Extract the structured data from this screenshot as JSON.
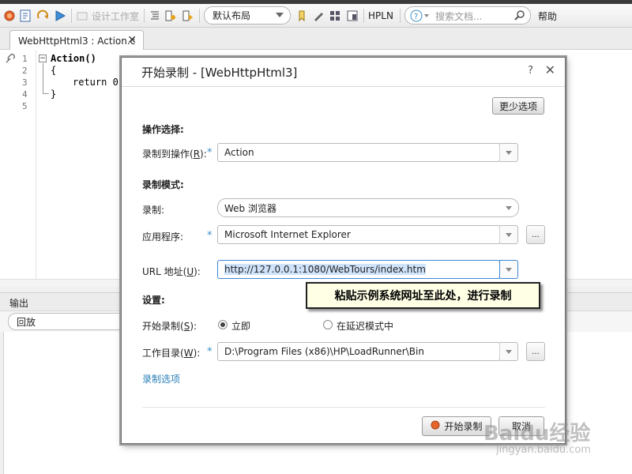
{
  "toolbar": {
    "design_workspace_label": "设计工作室",
    "layout_combo_value": "默认布局",
    "hpln_label": "HPLN",
    "search_placeholder": "搜索文档...",
    "help_label": "帮助"
  },
  "tab": {
    "title": "WebHttpHtml3 : Action.c"
  },
  "editor": {
    "line_numbers": [
      "1",
      "2",
      "3",
      "4",
      "5"
    ],
    "lines": [
      "Action()",
      "{",
      "return 0;",
      "}"
    ]
  },
  "output": {
    "header": "输出",
    "replay_combo": "回放"
  },
  "dialog": {
    "title": "开始录制 - [WebHttpHtml3]",
    "help": "?",
    "close": "✕",
    "fewer_options": "更少选项",
    "section_action": "操作选择:",
    "record_into_label": "录制到操作(",
    "record_into_key": "R",
    "record_into_suffix": "):",
    "record_into_value": "Action",
    "section_mode": "录制模式:",
    "record_label": "录制:",
    "record_value": "Web 浏览器",
    "app_label": "应用程序:",
    "app_value": "Microsoft Internet Explorer",
    "url_label": "URL 地址(",
    "url_key": "U",
    "url_suffix": "):",
    "url_value": "http://127.0.0.1:1080/WebTours/index.htm",
    "section_settings": "设置:",
    "start_label": "开始录制(",
    "start_key": "S",
    "start_suffix": "):",
    "start_now": "立即",
    "start_delayed": "在延迟模式中",
    "workdir_label": "工作目录(",
    "workdir_key": "W",
    "workdir_suffix": "):",
    "workdir_value": "D:\\Program Files (x86)\\HP\\LoadRunner\\Bin",
    "browse": "...",
    "record_options_link": "录制选项",
    "start_button": "开始录制",
    "cancel_button": "取消"
  },
  "annotation": "粘贴示例系统网址至此处，进行录制",
  "watermark": {
    "brand": "Baidu经验",
    "url": "jingyan.baidu.com"
  },
  "colors": {
    "accent": "#2a7fb8",
    "tooltip_bg": "#ffffe6",
    "url_highlight": "#cfe3fb"
  }
}
